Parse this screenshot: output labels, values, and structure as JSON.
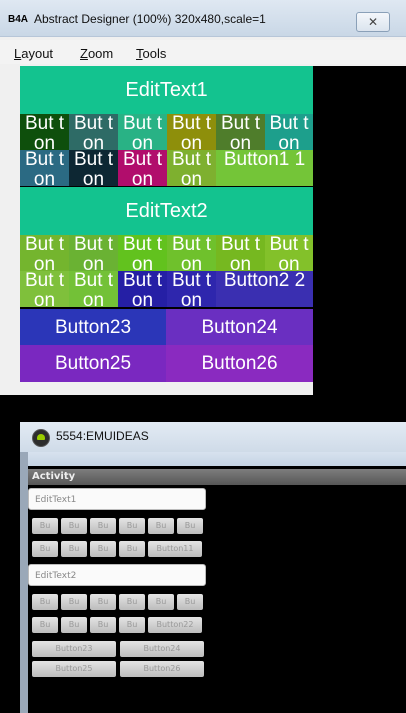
{
  "designer": {
    "app_icon": "B4A",
    "title": "Abstract Designer (100%) 320x480,scale=1",
    "close_glyph": "✕",
    "menu": [
      "Layout",
      "Zoom",
      "Tools"
    ],
    "views": {
      "edittext1": "EditText1",
      "edittext2": "EditText2",
      "row1": [
        "But ton",
        "But ton",
        "But ton",
        "But ton",
        "But ton",
        "But ton"
      ],
      "row2": [
        "But ton",
        "But ton",
        "But ton",
        "But ton",
        "Button1 1"
      ],
      "row3": [
        "But ton",
        "But ton",
        "But ton",
        "But ton",
        "But ton",
        "But ton"
      ],
      "row4": [
        "But ton",
        "But ton",
        "But ton",
        "But ton",
        "Button2 2"
      ],
      "button23": "Button23",
      "button24": "Button24",
      "button25": "Button25",
      "button26": "Button26"
    },
    "colors": {
      "edittext": "#13c38f",
      "row1": [
        "#0e4f0c",
        "#2e6b66",
        "#29b285",
        "#8e8f0b",
        "#4f7d2b",
        "#1d9f8c"
      ],
      "row2": [
        "#2b6a83",
        "#0d2733",
        "#b10d6c",
        "#7eb02f",
        "#74c538"
      ],
      "row3": [
        "#74b52e",
        "#6ab233",
        "#62c21e",
        "#6fc12c",
        "#76b820",
        "#83c12a"
      ],
      "row4": [
        "#7fc03b",
        "#73c137",
        "#251fa5",
        "#2e26ad",
        "#3a2fb1"
      ],
      "button23": "#2b36b8",
      "button24": "#6a2fc1",
      "button25": "#7a28c0",
      "button26": "#8a2ac0"
    }
  },
  "emulator": {
    "title": "5554:EMUIDEAS",
    "activity": "Activity",
    "edittext1": "EditText1",
    "edittext2": "EditText2",
    "small_btn": "Bu",
    "button11": "Button11",
    "button22": "Button22",
    "button23": "Button23",
    "button24": "Button24",
    "button25": "Button25",
    "button26": "Button26"
  }
}
